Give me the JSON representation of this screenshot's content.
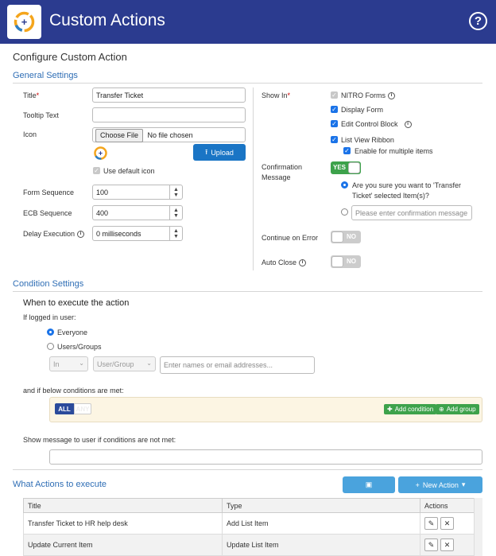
{
  "header": {
    "title": "Custom Actions",
    "help_glyph": "?"
  },
  "page_title": "Configure Custom Action",
  "general": {
    "title": "General Settings",
    "title_label": "Title",
    "title_value": "Transfer Ticket",
    "tooltip_label": "Tooltip Text",
    "tooltip_value": "",
    "icon_label": "Icon",
    "choose_file": "Choose File",
    "no_file": "No file chosen",
    "upload": "Upload",
    "use_default_icon": "Use default icon",
    "form_seq_label": "Form Sequence",
    "form_seq_value": "100",
    "ecb_seq_label": "ECB Sequence",
    "ecb_seq_value": "400",
    "delay_label": "Delay Execution",
    "delay_value": "0 milliseconds"
  },
  "showin": {
    "label": "Show In",
    "nitro_forms": "NITRO Forms",
    "display_form": "Display Form",
    "edit_control_block": "Edit Control Block",
    "list_view_ribbon": "List View Ribbon",
    "enable_multiple": "Enable for multiple items",
    "confirmation_label_1": "Confirmation",
    "confirmation_label_2": "Message",
    "confirm_toggle": "YES",
    "confirm_option_1a": "Are you sure you want to 'Transfer",
    "confirm_option_1b": "Ticket' selected Item(s)?",
    "confirm_placeholder": "Please enter confirmation message",
    "continue_on_error": "Continue on Error",
    "continue_toggle": "NO",
    "auto_close": "Auto Close",
    "auto_close_toggle": "NO"
  },
  "condition": {
    "title": "Condition Settings",
    "when_title": "When to execute the action",
    "if_logged": "If logged in user:",
    "everyone": "Everyone",
    "users_groups": "Users/Groups",
    "in_select": "In",
    "usergroup_select": "User/Group",
    "names_placeholder": "Enter names or email addresses...",
    "below_conditions": "and if below conditions are met:",
    "all": "ALL",
    "any": "ANY",
    "add_condition": "Add condition",
    "add_group": "Add group",
    "show_message": "Show message to user if conditions are not met:"
  },
  "actions": {
    "title": "What Actions to execute",
    "new_action": "New Action",
    "columns": [
      "Title",
      "Type",
      "Actions"
    ],
    "rows": [
      {
        "title": "Transfer Ticket to HR help desk",
        "type": "Add List Item"
      },
      {
        "title": "Update Current Item",
        "type": "Update List Item"
      }
    ]
  },
  "colors": {
    "header_bg": "#2b3b8f",
    "accent_blue": "#2f6eb5",
    "green": "#3da24b"
  }
}
